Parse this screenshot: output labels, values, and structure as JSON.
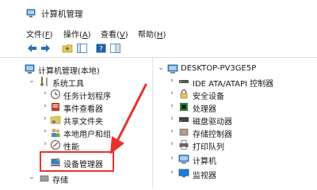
{
  "window": {
    "title": "计算机管理"
  },
  "menubar": {
    "items": [
      {
        "label": "文件(",
        "key": "F",
        "end": ")"
      },
      {
        "label": "操作(",
        "key": "A",
        "end": ")"
      },
      {
        "label": "查看(",
        "key": "V",
        "end": ")"
      },
      {
        "label": "帮助(",
        "key": "H",
        "end": ")"
      }
    ]
  },
  "left_tree": {
    "root": "计算机管理(本地)",
    "system_tools": "系统工具",
    "items": [
      "任务计划程序",
      "事件查看器",
      "共享文件夹",
      "本地用户和组",
      "性能",
      "设备管理器"
    ],
    "storage": "存储"
  },
  "right_tree": {
    "root": "DESKTOP-PV3GE5P",
    "items": [
      "IDE ATA/ATAPI 控制器",
      "安全设备",
      "处理器",
      "磁盘驱动器",
      "存储控制器",
      "打印队列",
      "计算机",
      "监视器"
    ]
  },
  "colors": {
    "highlight": "#e8312f",
    "accent": "#1e7bd6"
  }
}
